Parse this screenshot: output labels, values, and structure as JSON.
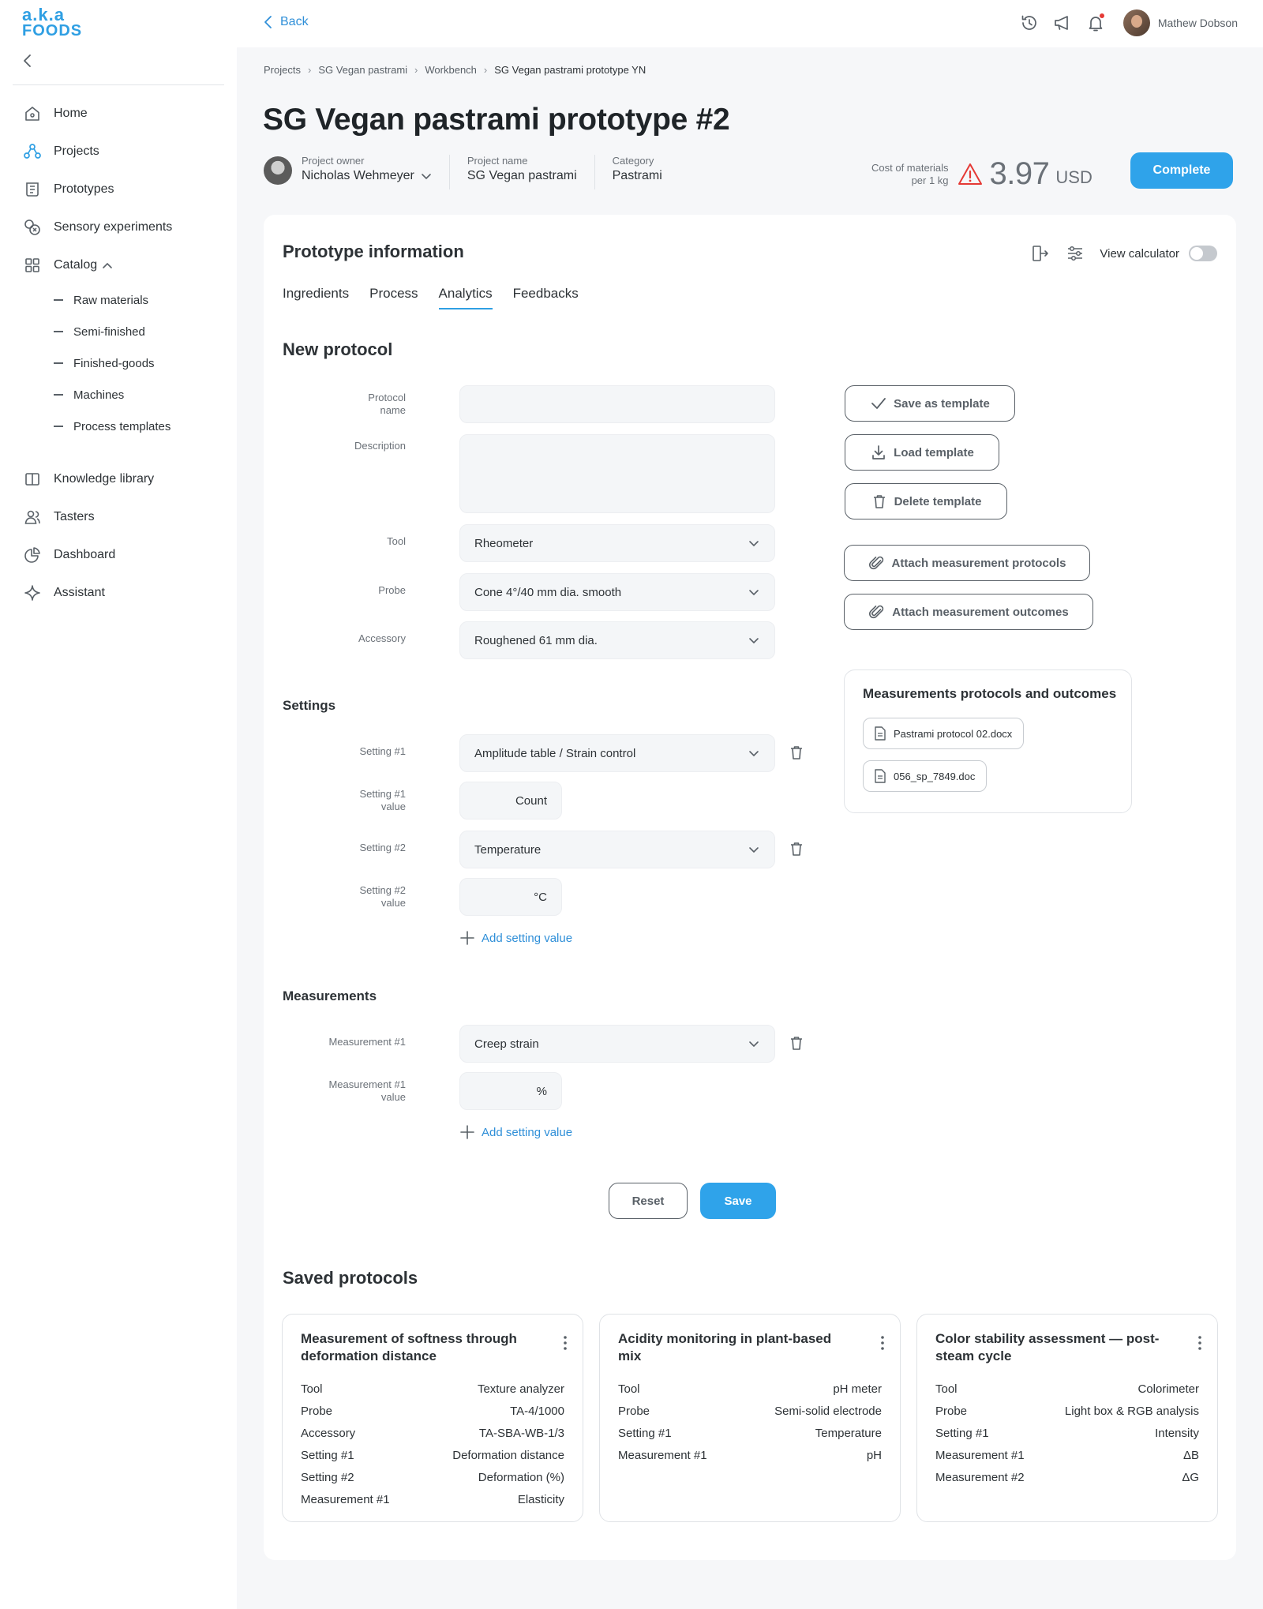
{
  "brand": {
    "line1": "a.k.a",
    "line2": "FOODS",
    "accent": "#2fa3ea"
  },
  "sidebar": {
    "items": [
      {
        "label": "Home",
        "icon": "home-icon"
      },
      {
        "label": "Projects",
        "icon": "projects-icon"
      },
      {
        "label": "Prototypes",
        "icon": "prototypes-icon"
      },
      {
        "label": "Sensory experiments",
        "icon": "sensory-icon"
      },
      {
        "label": "Catalog",
        "icon": "catalog-icon"
      },
      {
        "label": "Knowledge library",
        "icon": "book-icon"
      },
      {
        "label": "Tasters",
        "icon": "tasters-icon"
      },
      {
        "label": "Dashboard",
        "icon": "dashboard-icon"
      },
      {
        "label": "Assistant",
        "icon": "sparkle-icon"
      }
    ],
    "catalog_sub": [
      "Raw materials",
      "Semi-finished",
      "Finished-goods",
      "Machines",
      "Process templates"
    ]
  },
  "topbar": {
    "back": "Back",
    "user_name": "Mathew Dobson"
  },
  "breadcrumb": [
    "Projects",
    "SG Vegan pastrami",
    "Workbench",
    "SG Vegan pastrami prototype YN"
  ],
  "page": {
    "title": "SG Vegan pastrami prototype #2"
  },
  "meta": {
    "owner_label": "Project owner",
    "owner": "Nicholas Wehmeyer",
    "name_label": "Project name",
    "name": "SG Vegan pastrami",
    "category_label": "Category",
    "category": "Pastrami"
  },
  "cost": {
    "label1": "Cost of materials",
    "label2": "per 1 kg",
    "value": "3.97",
    "currency": "USD",
    "warn_color": "#e53935"
  },
  "complete_label": "Complete",
  "card": {
    "title": "Prototype information",
    "view_calculator": "View calculator",
    "tabs": [
      "Ingredients",
      "Process",
      "Analytics",
      "Feedbacks"
    ],
    "active_tab": "Analytics"
  },
  "protocol": {
    "heading": "New protocol",
    "labels": {
      "name1": "Protocol",
      "name2": "name",
      "description": "Description",
      "tool": "Tool",
      "probe": "Probe",
      "accessory": "Accessory"
    },
    "values": {
      "name": "",
      "description": "",
      "tool": "Rheometer",
      "probe": "Cone 4°/40 mm dia. smooth",
      "accessory": "Roughened 61 mm dia."
    },
    "settings_heading": "Settings",
    "settings": {
      "s1_label": "Setting #1",
      "s1_value": "Amplitude table / Strain control",
      "s1v_label1": "Setting #1",
      "s1v_label2": "value",
      "s1v_unit": "Count",
      "s2_label": "Setting #2",
      "s2_value": "Temperature",
      "s2v_label1": "Setting #2",
      "s2v_label2": "value",
      "s2v_unit": "°C",
      "add": "Add setting value"
    },
    "measurements_heading": "Measurements",
    "measurements": {
      "m1_label": "Measurement #1",
      "m1_value": "Creep strain",
      "m1v_label1": "Measurement #1",
      "m1v_label2": "value",
      "m1v_unit": "%",
      "add": "Add setting value"
    },
    "reset": "Reset",
    "save": "Save"
  },
  "template_buttons": {
    "save": "Save as template",
    "load": "Load template",
    "delete": "Delete template",
    "attach_protocols": "Attach measurement protocols",
    "attach_outcomes": "Attach measurement outcomes"
  },
  "attachments": {
    "title": "Measurements protocols and outcomes",
    "files": [
      "Pastrami protocol 02.docx",
      "056_sp_7849.doc"
    ]
  },
  "saved": {
    "heading": "Saved protocols",
    "cards": [
      {
        "title": "Measurement of softness through deformation distance",
        "rows": [
          [
            "Tool",
            "Texture analyzer"
          ],
          [
            "Probe",
            "TA-4/1000"
          ],
          [
            "Accessory",
            "TA-SBA-WB-1/3"
          ],
          [
            "Setting #1",
            "Deformation distance"
          ],
          [
            "Setting #2",
            "Deformation (%)"
          ],
          [
            "Measurement #1",
            "Elasticity"
          ]
        ]
      },
      {
        "title": "Acidity monitoring in plant-based mix",
        "rows": [
          [
            "Tool",
            "pH meter"
          ],
          [
            "Probe",
            "Semi-solid electrode"
          ],
          [
            "Setting #1",
            "Temperature"
          ],
          [
            "Measurement #1",
            "pH"
          ]
        ]
      },
      {
        "title": "Color stability assessment — post-steam cycle",
        "rows": [
          [
            "Tool",
            "Colorimeter"
          ],
          [
            "Probe",
            "Light box & RGB analysis"
          ],
          [
            "Setting #1",
            "Intensity"
          ],
          [
            "Measurement #1",
            "ΔB"
          ],
          [
            "Measurement #2",
            "ΔG"
          ]
        ]
      }
    ]
  }
}
